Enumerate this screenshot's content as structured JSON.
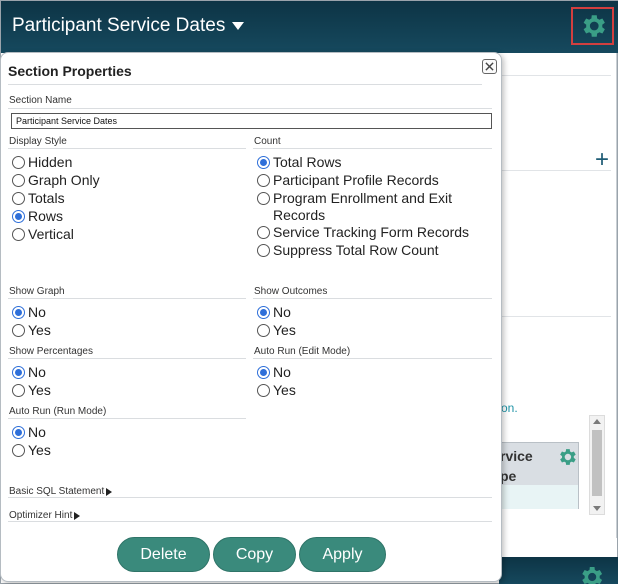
{
  "header": {
    "title": "Participant Service Dates"
  },
  "background": {
    "link_text": "on.",
    "table_header_line1": "rvice",
    "table_header_line2": "pe"
  },
  "dialog": {
    "title": "Section Properties",
    "section_name_label": "Section Name",
    "section_name_value": "Participant Service Dates",
    "display_style": {
      "label": "Display Style",
      "options": [
        "Hidden",
        "Graph Only",
        "Totals",
        "Rows",
        "Vertical"
      ],
      "selected": "Rows"
    },
    "count": {
      "label": "Count",
      "options": [
        "Total Rows",
        "Participant Profile Records",
        "Program Enrollment and Exit Records",
        "Service Tracking Form Records",
        "Suppress Total Row Count"
      ],
      "selected": "Total Rows"
    },
    "show_graph": {
      "label": "Show Graph",
      "options": [
        "No",
        "Yes"
      ],
      "selected": "No"
    },
    "show_outcomes": {
      "label": "Show Outcomes",
      "options": [
        "No",
        "Yes"
      ],
      "selected": "No"
    },
    "show_percentages": {
      "label": "Show Percentages",
      "options": [
        "No",
        "Yes"
      ],
      "selected": "No"
    },
    "auto_run_edit": {
      "label": "Auto Run (Edit Mode)",
      "options": [
        "No",
        "Yes"
      ],
      "selected": "No"
    },
    "auto_run_run": {
      "label": "Auto Run (Run Mode)",
      "options": [
        "No",
        "Yes"
      ],
      "selected": "No"
    },
    "basic_sql_label": "Basic SQL Statement",
    "optimizer_hint_label": "Optimizer Hint",
    "buttons": {
      "delete": "Delete",
      "copy": "Copy",
      "apply": "Apply"
    }
  },
  "colors": {
    "header_bg": "#0d3445",
    "accent_button": "#3a8a7c",
    "radio_checked": "#2e6fd9",
    "gear_highlight": "#d23f3f"
  }
}
